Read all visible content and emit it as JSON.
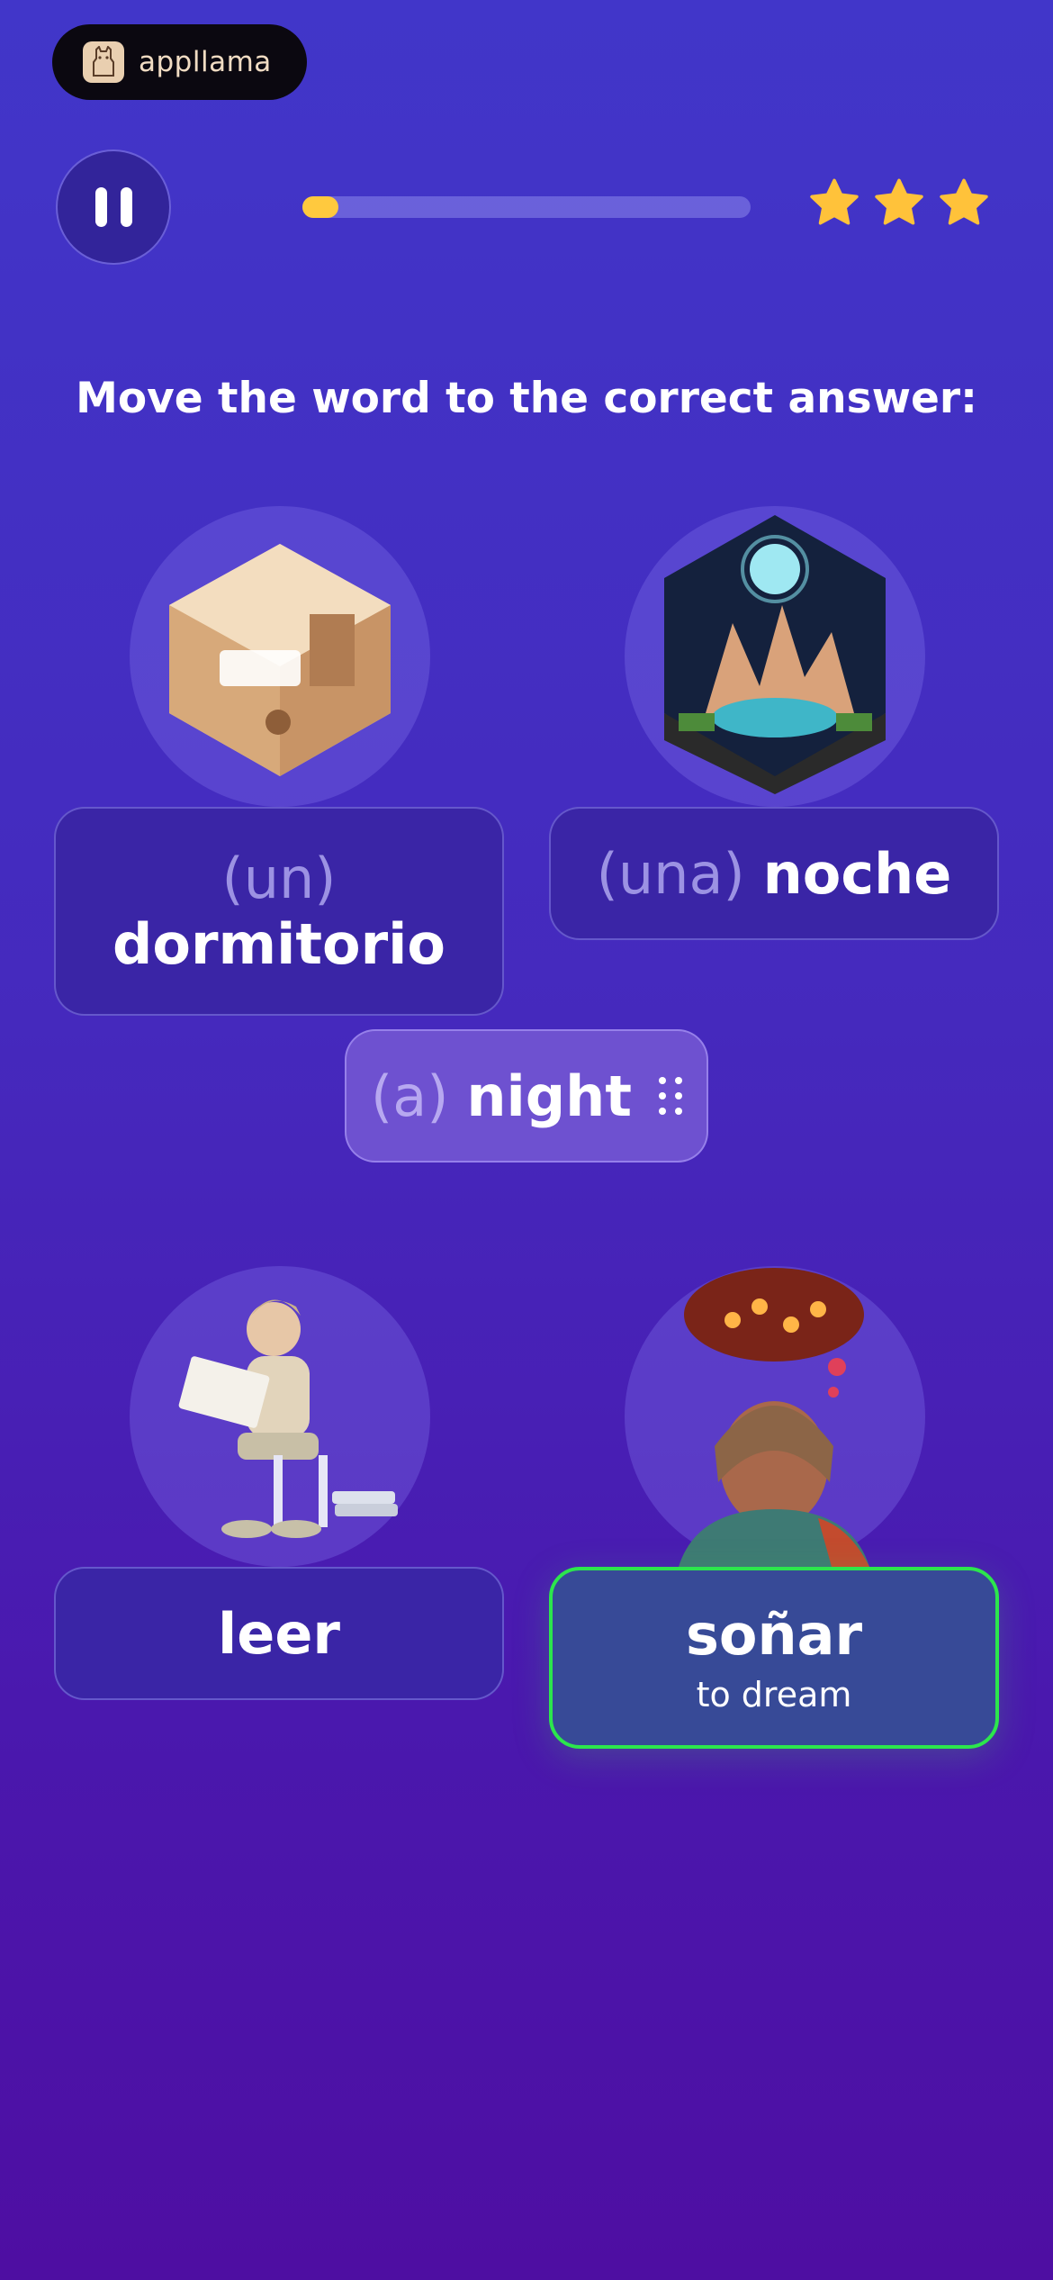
{
  "logo": {
    "text": "appllama",
    "icon": "llama-icon"
  },
  "controls": {
    "pause_icon": "pause-icon"
  },
  "progress": {
    "fraction": 0.08,
    "color": "#FFC93E"
  },
  "stars": {
    "count": 3,
    "color": "#FFC23A",
    "icon": "star-icon"
  },
  "prompt": "Move the word to the correct answer:",
  "cards": [
    {
      "article": "(un)",
      "word": "dormitorio",
      "subtitle": "",
      "image": "bedroom-image"
    },
    {
      "article": "(una)",
      "word": "noche",
      "subtitle": "",
      "image": "night-landscape-image"
    },
    {
      "article": "",
      "word": "leer",
      "subtitle": "",
      "image": "reading-boy-image"
    },
    {
      "article": "",
      "word": "soñar",
      "subtitle": "to dream",
      "image": "dreaming-woman-image",
      "selected": true
    }
  ],
  "drag_chip": {
    "article": "(a)",
    "word": "night",
    "icon": "drag-handle-icon"
  },
  "colors": {
    "selected_border": "#2CE64D",
    "card_bg": "#3A25A6",
    "accent": "#FFC93E"
  }
}
